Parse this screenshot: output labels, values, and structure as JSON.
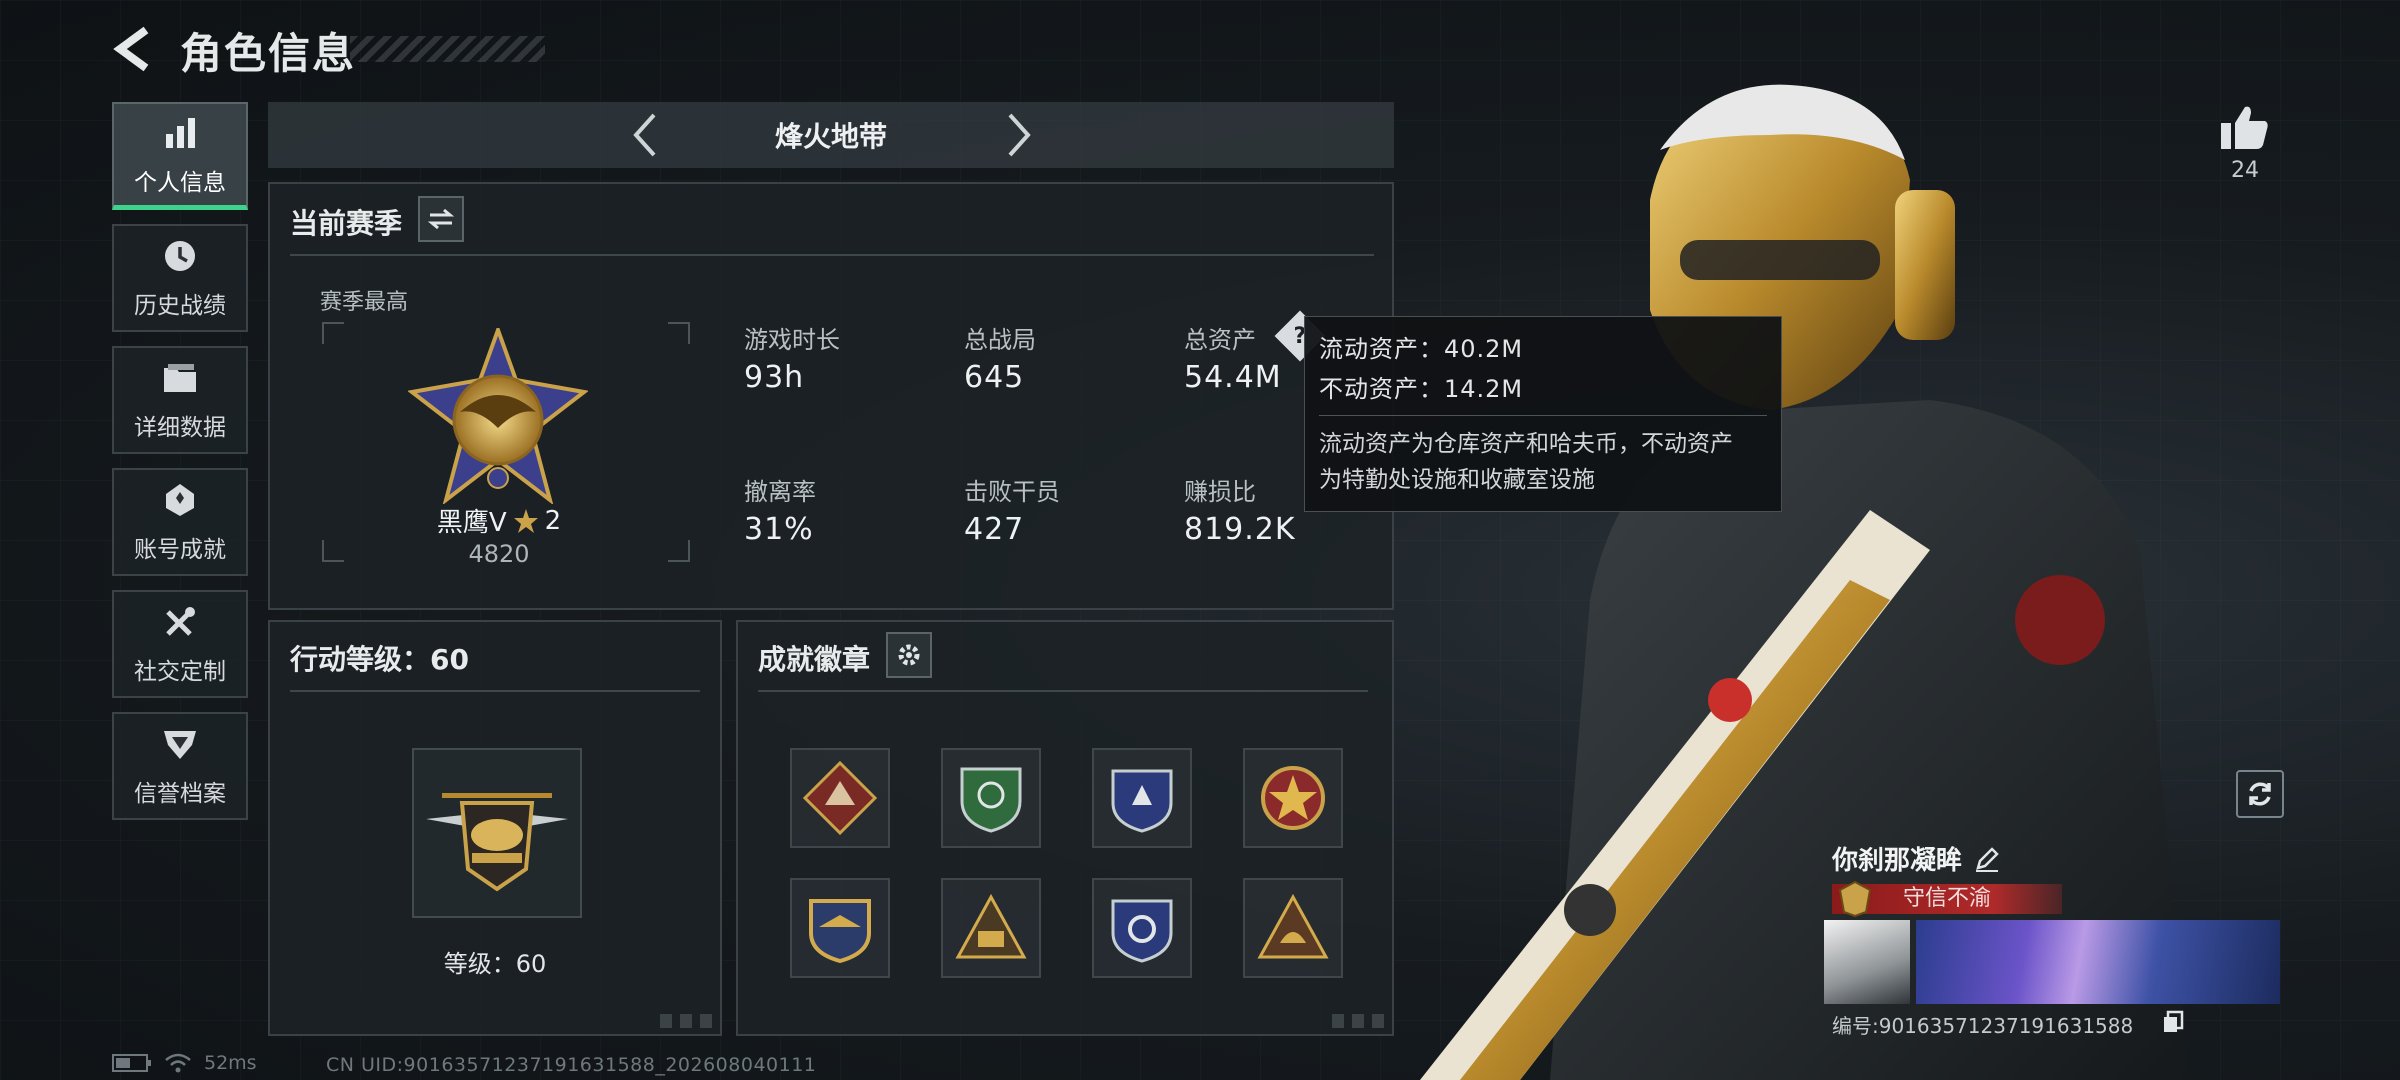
{
  "header": {
    "title": "角色信息"
  },
  "sidebar": {
    "items": [
      {
        "label": "个人信息",
        "icon": "bar-chart-icon",
        "active": true
      },
      {
        "label": "历史战绩",
        "icon": "history-clock-icon"
      },
      {
        "label": "详细数据",
        "icon": "folder-icon"
      },
      {
        "label": "账号成就",
        "icon": "achievement-icon"
      },
      {
        "label": "社交定制",
        "icon": "tools-icon"
      },
      {
        "label": "信誉档案",
        "icon": "shield-badge-icon"
      }
    ]
  },
  "mode": {
    "title": "烽火地带"
  },
  "season": {
    "title": "当前赛季",
    "best_label": "赛季最高",
    "rank_name": "黑鹰V",
    "rank_stars": "2",
    "rank_score": "4820",
    "stats": [
      {
        "label": "游戏时长",
        "value": "93h"
      },
      {
        "label": "总战局",
        "value": "645"
      },
      {
        "label": "总资产",
        "value": "54.4M"
      },
      {
        "label": "撤离率",
        "value": "31%"
      },
      {
        "label": "击败干员",
        "value": "427"
      },
      {
        "label": "赚损比",
        "value": "819.2K"
      }
    ]
  },
  "tooltip": {
    "liquid": "流动资产：40.2M",
    "fixed": "不动资产：14.2M",
    "desc_line1": "流动资产为仓库资产和哈夫币，不动资产",
    "desc_line2": "为特勤处设施和收藏室设施"
  },
  "level": {
    "title": "行动等级：60",
    "label": "等级：60"
  },
  "achievements": {
    "title": "成就徽章",
    "badges": [
      "wolf-badge",
      "green-shield-badge",
      "blue-star-shield-badge",
      "red-star-badge",
      "gold-wing-badge",
      "gold-triangle-team-badge",
      "blue-knot-shield-badge",
      "gold-triangle-helmet-badge"
    ]
  },
  "profile": {
    "likes": "24",
    "name": "你刹那凝眸",
    "honor": "守信不渝",
    "id_text": "编号:9016357123719163158​8"
  },
  "status": {
    "ping": "52ms",
    "uid": "CN UID:9016357123719163158​8_202608040111"
  },
  "colors": {
    "accent_green": "#3fd28a",
    "honor_red": "#b02a2a",
    "gold": "#c9a24a"
  }
}
